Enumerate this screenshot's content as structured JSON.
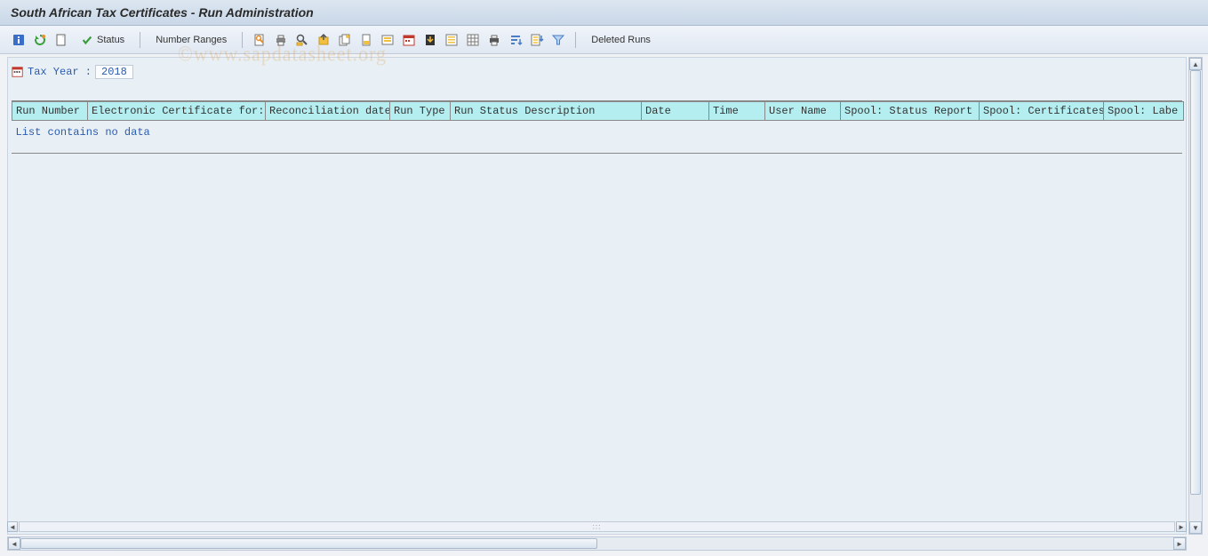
{
  "title": "South African Tax Certificates - Run Administration",
  "toolbar": {
    "status_label": "Status",
    "number_ranges_label": "Number Ranges",
    "deleted_runs_label": "Deleted Runs"
  },
  "tax_year": {
    "label": "Tax Year :",
    "value": "2018"
  },
  "table": {
    "columns": [
      "Run Number",
      "Electronic Certificate for:",
      "Reconciliation date",
      "Run Type",
      "Run Status Description",
      "Date",
      "Time",
      "User Name",
      "Spool: Status Report",
      "Spool: Certificates",
      "Spool: Labe"
    ],
    "empty_text": "List contains no data"
  },
  "watermark": "©www.sapdatasheet.org"
}
